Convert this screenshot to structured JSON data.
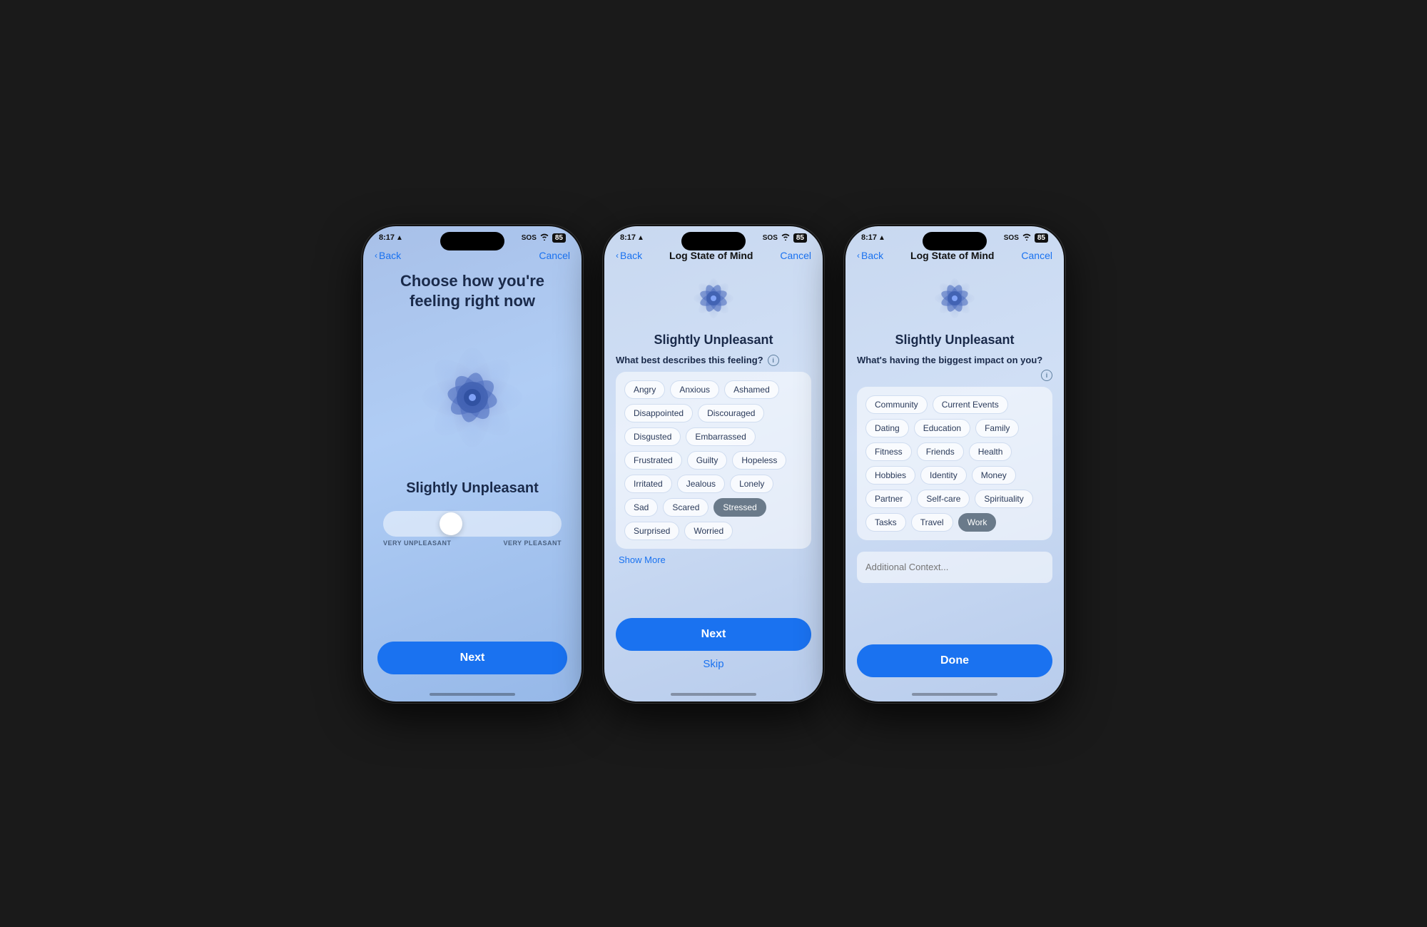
{
  "phone1": {
    "status": {
      "time": "8:17",
      "location": "▲",
      "sos": "SOS",
      "wifi": "wifi",
      "battery": "85"
    },
    "nav": {
      "back": "Back",
      "cancel": "Cancel"
    },
    "title": "Choose how you're feeling right now",
    "mood_label": "Slightly Unpleasant",
    "slider": {
      "left": "VERY UNPLEASANT",
      "right": "VERY PLEASANT"
    },
    "next_button": "Next"
  },
  "phone2": {
    "status": {
      "time": "8:17"
    },
    "nav": {
      "back": "Back",
      "title": "Log State of Mind",
      "cancel": "Cancel"
    },
    "mood_label": "Slightly Unpleasant",
    "section_title": "What best describes this feeling?",
    "tags": [
      {
        "label": "Angry",
        "selected": false
      },
      {
        "label": "Anxious",
        "selected": false
      },
      {
        "label": "Ashamed",
        "selected": false
      },
      {
        "label": "Disappointed",
        "selected": false
      },
      {
        "label": "Discouraged",
        "selected": false
      },
      {
        "label": "Disgusted",
        "selected": false
      },
      {
        "label": "Embarrassed",
        "selected": false
      },
      {
        "label": "Frustrated",
        "selected": false
      },
      {
        "label": "Guilty",
        "selected": false
      },
      {
        "label": "Hopeless",
        "selected": false
      },
      {
        "label": "Irritated",
        "selected": false
      },
      {
        "label": "Jealous",
        "selected": false
      },
      {
        "label": "Lonely",
        "selected": false
      },
      {
        "label": "Sad",
        "selected": false
      },
      {
        "label": "Scared",
        "selected": false
      },
      {
        "label": "Stressed",
        "selected": true
      },
      {
        "label": "Surprised",
        "selected": false
      },
      {
        "label": "Worried",
        "selected": false
      }
    ],
    "show_more": "Show More",
    "next_button": "Next",
    "skip_button": "Skip"
  },
  "phone3": {
    "status": {
      "time": "8:17"
    },
    "nav": {
      "back": "Back",
      "title": "Log State of Mind",
      "cancel": "Cancel"
    },
    "mood_label": "Slightly Unpleasant",
    "section_title": "What's having the biggest impact on you?",
    "tags": [
      {
        "label": "Community",
        "selected": false
      },
      {
        "label": "Current Events",
        "selected": false
      },
      {
        "label": "Dating",
        "selected": false
      },
      {
        "label": "Education",
        "selected": false
      },
      {
        "label": "Family",
        "selected": false
      },
      {
        "label": "Fitness",
        "selected": false
      },
      {
        "label": "Friends",
        "selected": false
      },
      {
        "label": "Health",
        "selected": false
      },
      {
        "label": "Hobbies",
        "selected": false
      },
      {
        "label": "Identity",
        "selected": false
      },
      {
        "label": "Money",
        "selected": false
      },
      {
        "label": "Partner",
        "selected": false
      },
      {
        "label": "Self-care",
        "selected": false
      },
      {
        "label": "Spirituality",
        "selected": false
      },
      {
        "label": "Tasks",
        "selected": false
      },
      {
        "label": "Travel",
        "selected": false
      },
      {
        "label": "Work",
        "selected": true
      }
    ],
    "context_placeholder": "Additional Context...",
    "done_button": "Done"
  }
}
